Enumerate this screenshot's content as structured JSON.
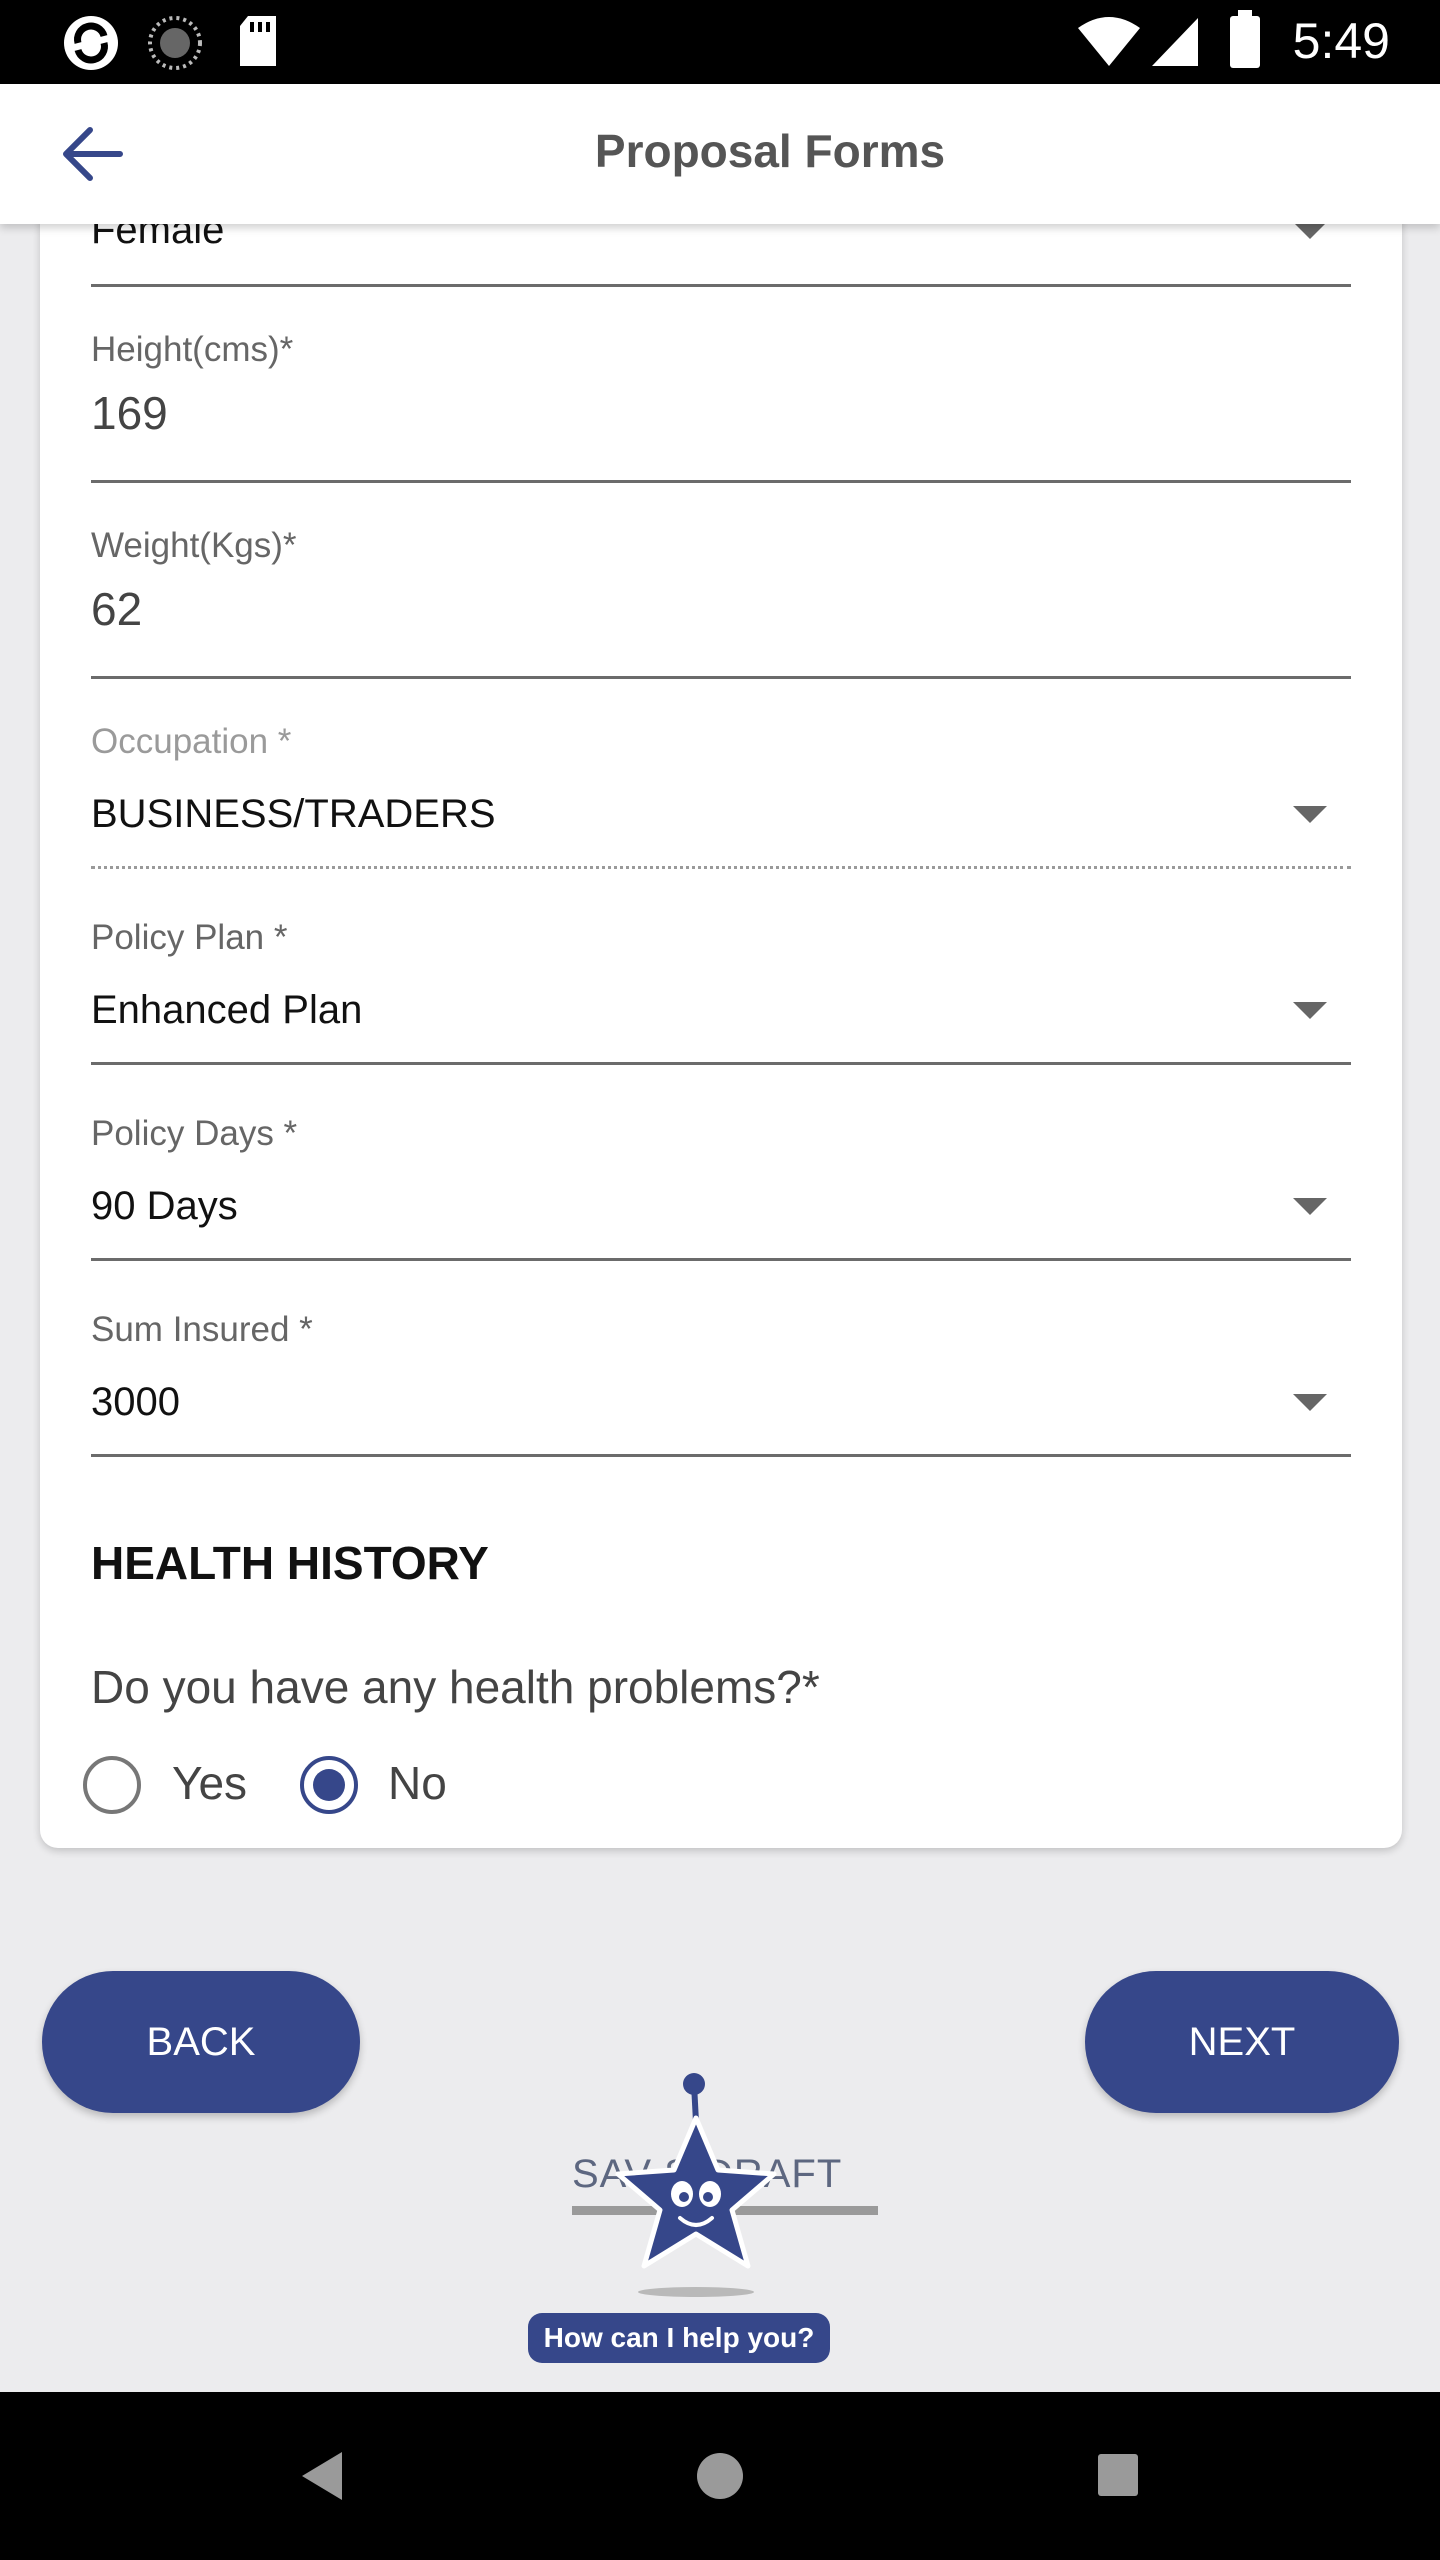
{
  "status_bar": {
    "time": "5:49",
    "left_icons": [
      "app-notification-icon",
      "sync-icon",
      "sd-card-icon"
    ],
    "right_icons": [
      "wifi-icon",
      "signal-icon",
      "battery-icon"
    ]
  },
  "app_bar": {
    "title": "Proposal Forms",
    "back_icon": "arrow-left-icon"
  },
  "form": {
    "gender": {
      "value": "Female"
    },
    "height": {
      "label": "Height(cms)*",
      "value": "169"
    },
    "weight": {
      "label": "Weight(Kgs)*",
      "value": "62"
    },
    "occupation": {
      "label": "Occupation *",
      "value": "BUSINESS/TRADERS"
    },
    "policy_plan": {
      "label": "Policy Plan *",
      "value": "Enhanced Plan"
    },
    "policy_days": {
      "label": "Policy Days *",
      "value": "90 Days"
    },
    "sum_insured": {
      "label": "Sum Insured *",
      "value": "3000"
    }
  },
  "health_history": {
    "title": "HEALTH HISTORY",
    "question": "Do you have any health problems?*",
    "options": [
      {
        "label": "Yes",
        "selected": false
      },
      {
        "label": "No",
        "selected": true
      }
    ]
  },
  "buttons": {
    "back": "BACK",
    "next": "NEXT"
  },
  "chat_widget": {
    "brand": "SAV  S DRAFT",
    "help_text": "How can I help you?"
  },
  "colors": {
    "primary": "#36478a",
    "background": "#ececee",
    "card": "#ffffff"
  }
}
